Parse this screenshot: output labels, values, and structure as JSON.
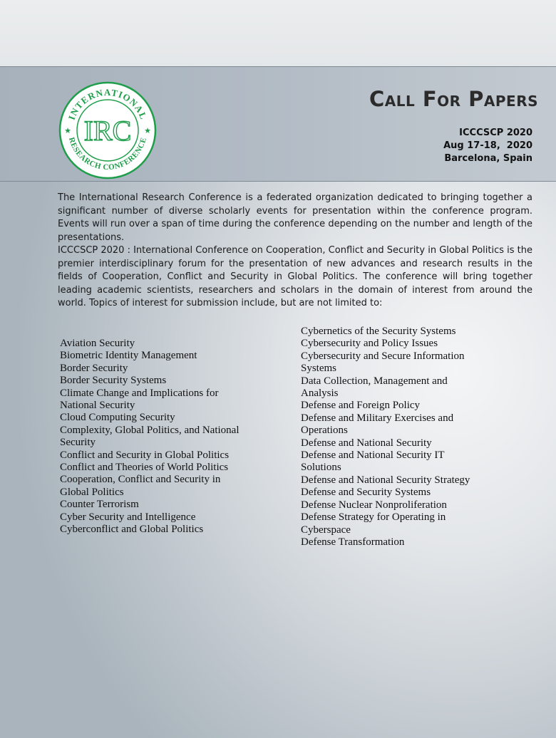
{
  "header": {
    "logo": {
      "ring_text": "INTERNATIONAL RESEARCH CONFERENCE",
      "monogram": "IRC",
      "color": "#1e9e4a"
    },
    "title": "Call For Papers",
    "conference_code": "ICCCSCP 2020",
    "dates": "Aug 17-18,  2020",
    "location": "Barcelona, Spain"
  },
  "intro": "The International Research Conference is a federated organization dedicated to bringing together a significant number of diverse scholarly events for presentation within the conference program. Events will run over a span of time during the conference depending on the number and length of the presentations.",
  "about": "ICCCSCP 2020 :  International Conference on Cooperation, Conflict and Security in Global Politics  is the premier interdisciplinary forum for the presentation of new advances and research results in the fields of  Cooperation, Conflict and Security in Global Politics. The conference will bring together leading academic scientists, researchers and scholars in the domain of interest from around the world. Topics of interest for submission include, but are not limited to:",
  "topics_left": [
    "Aviation Security",
    "Biometric Identity Management",
    "Border Security",
    "Border Security Systems",
    "Climate Change and Implications for National Security",
    "Cloud Computing Security",
    "Complexity, Global Politics, and National Security",
    "Conflict and Security in Global Politics",
    "Conflict and Theories of World Politics",
    "Cooperation, Conflict and Security in Global Politics",
    "Counter Terrorism",
    "Cyber Security and Intelligence",
    "Cyberconflict and Global Politics"
  ],
  "topics_right": [
    "Cybernetics of the Security Systems",
    "Cybersecurity and Policy Issues",
    "Cybersecurity and Secure Information Systems",
    "Data Collection, Management and Analysis",
    "Defense and Foreign Policy",
    "Defense and Military Exercises and Operations",
    "Defense and National Security",
    "Defense and National Security IT Solutions",
    "Defense and National Security Strategy",
    "Defense and Security Systems",
    "Defense Nuclear Nonproliferation",
    "Defense Strategy for Operating in Cyberspace",
    "Defense Transformation"
  ]
}
